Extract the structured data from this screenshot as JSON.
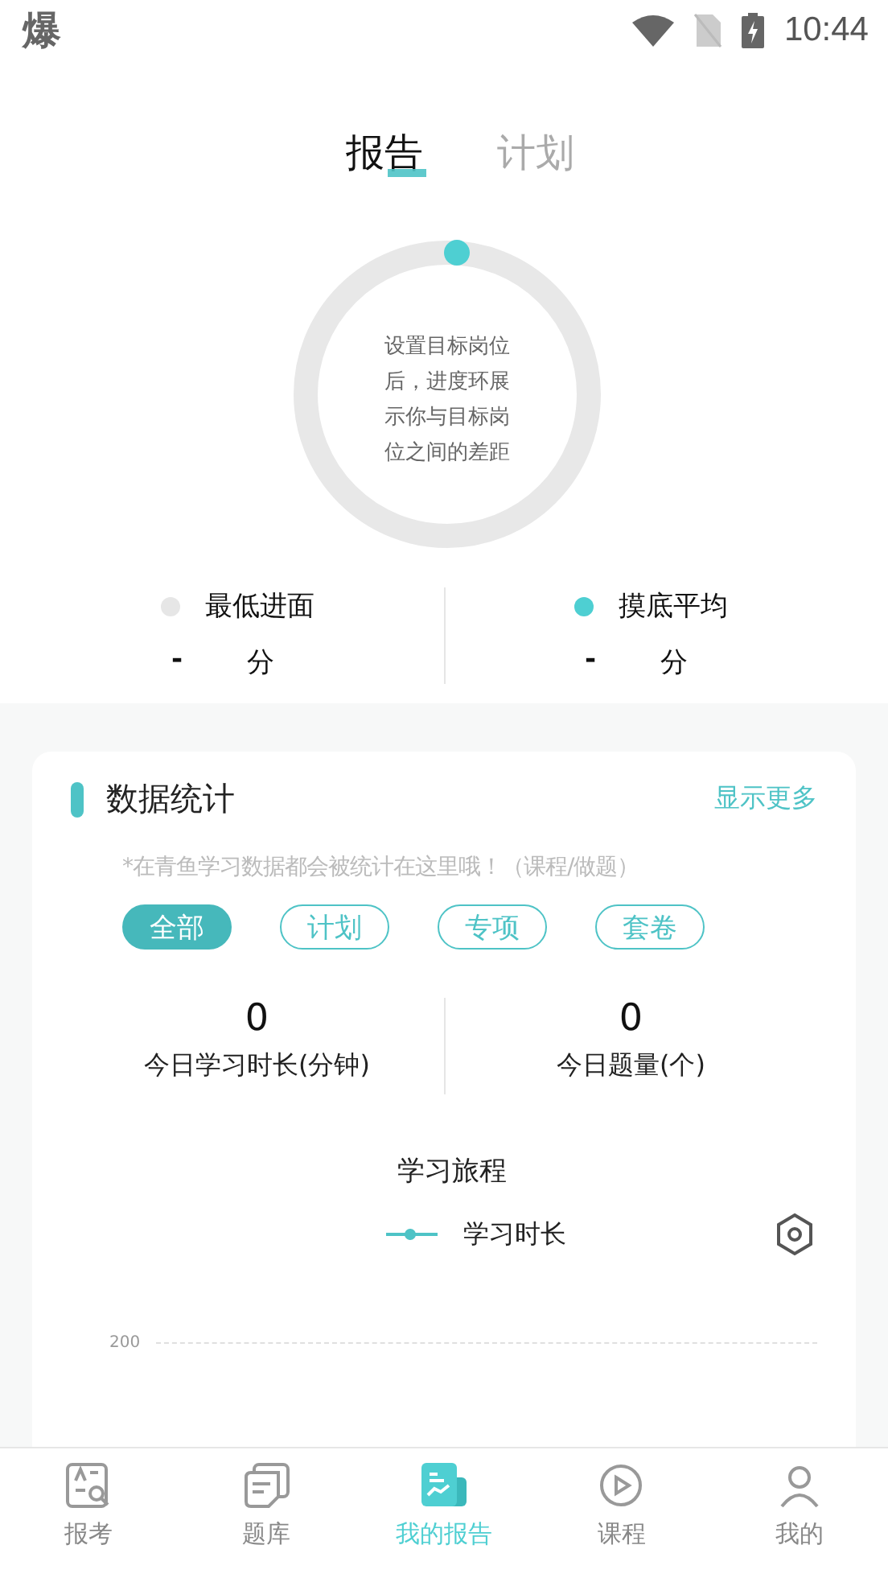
{
  "status_bar": {
    "app_glyph": "爆",
    "time": "10:44"
  },
  "tabs": [
    {
      "label": "报告",
      "selected": true
    },
    {
      "label": "计划",
      "selected": false
    }
  ],
  "ring": {
    "hint": "设置目标岗位后，进度环展示你与目标岗位之间的差距"
  },
  "scores": [
    {
      "label": "最低进面",
      "color": "#e6e6e6",
      "value": "-",
      "unit": "分"
    },
    {
      "label": "摸底平均",
      "color": "#4ecfd2",
      "value": "-",
      "unit": "分"
    }
  ],
  "stats_card": {
    "title": "数据统计",
    "more": "显示更多",
    "note": "*在青鱼学习数据都会被统计在这里哦！（课程/做题）",
    "filters": [
      {
        "label": "全部",
        "selected": true
      },
      {
        "label": "计划",
        "selected": false
      },
      {
        "label": "专项",
        "selected": false
      },
      {
        "label": "套卷",
        "selected": false
      }
    ],
    "metrics": [
      {
        "value": "0",
        "label": "今日学习时长(分钟)"
      },
      {
        "value": "0",
        "label": "今日题量(个)"
      }
    ],
    "journey": {
      "title": "学习旅程",
      "legend": "学习时长",
      "axis_label": "200"
    }
  },
  "bottom_nav": [
    {
      "label": "报考",
      "kind": "exam",
      "selected": false
    },
    {
      "label": "题库",
      "kind": "bank",
      "selected": false
    },
    {
      "label": "我的报告",
      "kind": "report",
      "selected": true
    },
    {
      "label": "课程",
      "kind": "course",
      "selected": false
    },
    {
      "label": "我的",
      "kind": "me",
      "selected": false
    }
  ]
}
